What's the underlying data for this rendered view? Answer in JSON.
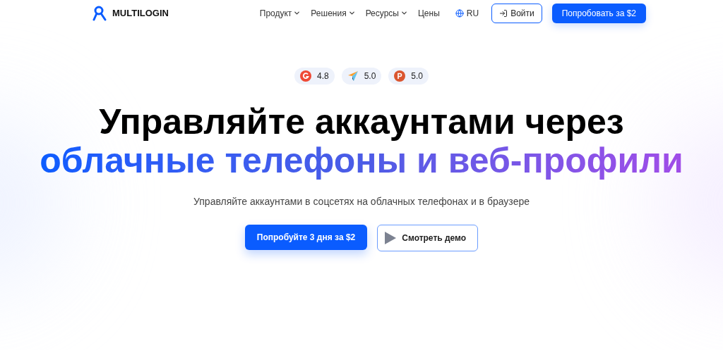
{
  "header": {
    "logo": "MULTILOGIN",
    "nav": [
      {
        "label": "Продукт",
        "dropdown": true
      },
      {
        "label": "Решения",
        "dropdown": true
      },
      {
        "label": "Ресурсы",
        "dropdown": true
      },
      {
        "label": "Цены",
        "dropdown": false
      }
    ],
    "language": "RU",
    "login": "Войти",
    "cta": "Попробовать за $2"
  },
  "ratings": [
    {
      "kind": "g2",
      "score": "4.8"
    },
    {
      "kind": "capterra",
      "score": "5.0"
    },
    {
      "kind": "producthunt",
      "score": "5.0"
    }
  ],
  "hero": {
    "title_line1": "Управляйте аккаунтами через",
    "title_line2": "облачные телефоны и веб-профили",
    "subtitle": "Управляйте аккаунтами в соцсетях на облачных телефонах и в браузере",
    "primary_button": "Попробуйте 3 дня за $2",
    "secondary_button": "Смотреть демо"
  }
}
